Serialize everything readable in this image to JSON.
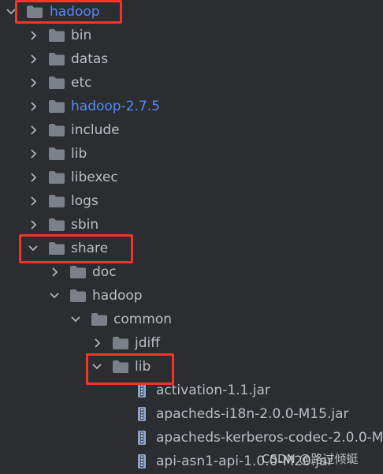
{
  "tree": {
    "items": [
      {
        "label": "hadoop"
      },
      {
        "label": "bin"
      },
      {
        "label": "datas"
      },
      {
        "label": "etc"
      },
      {
        "label": "hadoop-2.7.5"
      },
      {
        "label": "include"
      },
      {
        "label": "lib"
      },
      {
        "label": "libexec"
      },
      {
        "label": "logs"
      },
      {
        "label": "sbin"
      },
      {
        "label": "share"
      },
      {
        "label": "doc"
      },
      {
        "label": "hadoop"
      },
      {
        "label": "common"
      },
      {
        "label": "jdiff"
      },
      {
        "label": "lib"
      },
      {
        "label": "activation-1.1.jar"
      },
      {
        "label": "apacheds-i18n-2.0.0-M15.jar"
      },
      {
        "label": "apacheds-kerberos-codec-2.0.0-M"
      },
      {
        "label": "api-asn1-api-1.0.0-M20.jar"
      }
    ]
  },
  "watermark": "CSDN @路过倾蜓",
  "colors": {
    "background": "#2b2d30",
    "text": "#bcbec4",
    "module_text": "#548af7",
    "folder": "#7b8089",
    "chevron": "#aeb2ba",
    "jar_icon": "#8fa4c8",
    "highlight": "#f0352a"
  },
  "icons": {
    "folder": "folder-icon",
    "jar": "jar-file-icon",
    "expanded": "chevron-down-icon",
    "collapsed": "chevron-right-icon"
  }
}
